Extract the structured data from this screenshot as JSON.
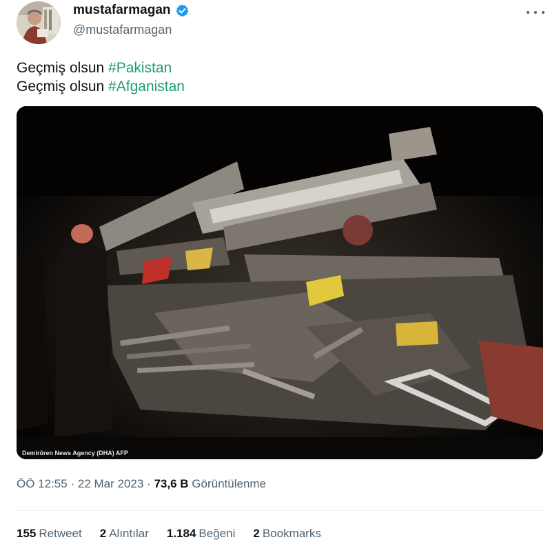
{
  "author": {
    "display_name": "mustafarmagan",
    "handle": "@mustafarmagan",
    "verified": true,
    "icons": {
      "verified": "verified-badge-icon",
      "more": "more-options-icon"
    }
  },
  "tweet": {
    "lines": [
      {
        "text": "Geçmiş olsun",
        "hashtag": "#Pakistan"
      },
      {
        "text": "Geçmiş olsun",
        "hashtag": "#Afganistan"
      }
    ],
    "media": {
      "description_icon": "earthquake-rubble-photo",
      "credit": "Demirören News Agency (DHA) AFP"
    }
  },
  "meta": {
    "time": "ÖÖ 12:55",
    "separator": "·",
    "date": "22 Mar 2023",
    "views_count": "73,6 B",
    "views_label": "Görüntülenme"
  },
  "stats": [
    {
      "count": "155",
      "label": "Retweet"
    },
    {
      "count": "2",
      "label": "Alıntılar"
    },
    {
      "count": "1.184",
      "label": "Beğeni"
    },
    {
      "count": "2",
      "label": "Bookmarks"
    }
  ],
  "colors": {
    "hashtag": "#1d9b76",
    "verified": "#1d9bf0",
    "secondary_text": "#536471",
    "primary_text": "#0f1419"
  }
}
